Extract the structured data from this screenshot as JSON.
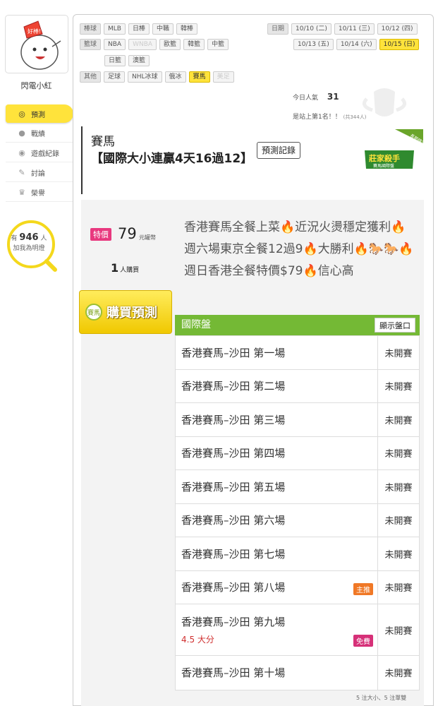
{
  "user": {
    "name": "閃電小紅",
    "avatar_bubble": "好棒!"
  },
  "nav": [
    {
      "label": "預測",
      "icon": "target-icon",
      "active": true
    },
    {
      "label": "戰績",
      "icon": "chat-icon",
      "active": false
    },
    {
      "label": "遊戲紀錄",
      "icon": "record-icon",
      "active": false
    },
    {
      "label": "討論",
      "icon": "discuss-icon",
      "active": false
    },
    {
      "label": "榮譽",
      "icon": "medal-icon",
      "active": false
    }
  ],
  "fans": {
    "prefix": "有",
    "count": "946",
    "suffix": "人",
    "line2": "加我為明燈"
  },
  "sports": {
    "baseball": {
      "label": "棒球",
      "items": [
        "MLB",
        "日棒",
        "中職",
        "韓棒"
      ]
    },
    "basketball": {
      "label": "籃球",
      "items": [
        "NBA",
        "WNBA",
        "歐籃",
        "韓籃",
        "中籃"
      ],
      "items2": [
        "日籃",
        "澳籃"
      ]
    },
    "other": {
      "label": "其他",
      "items": [
        "足球",
        "NHL冰球",
        "俄冰",
        "賽馬",
        "美足"
      ]
    }
  },
  "dates": {
    "label": "日期",
    "row1": [
      "10/10 (二)",
      "10/11 (三)",
      "10/12 (四)"
    ],
    "row2": [
      "10/13 (五)",
      "10/14 (六)",
      "10/15 (日)"
    ]
  },
  "popularity": {
    "label": "今日人氣",
    "value": "31"
  },
  "rank": {
    "text": "是站上第1名！！",
    "small": "(共344人)"
  },
  "title": {
    "line1": "賽馬",
    "line2": "【國際大小連贏4天16過12】",
    "button": "預測記錄",
    "badge_text": "莊家殺手",
    "badge_sub": "賽馬國際盤",
    "ribbon": "長期穩定"
  },
  "price": {
    "tag": "特價",
    "value": "79",
    "unit": "元罐幣"
  },
  "buyers": {
    "count": "1",
    "label": "人購買"
  },
  "buy_button": {
    "label": "購買預測",
    "icon_text": "賽馬"
  },
  "description": "香港賽馬全餐上菜🔥近況火燙穩定獲利🔥週六場東京全餐12過9🔥大勝利🔥🐎🐎🔥週日香港全餐特價$79🔥信心高",
  "pan": {
    "title": "國際盤",
    "button": "顯示盤口"
  },
  "races": [
    {
      "name": "香港賽馬–沙田 第一場",
      "status": "未開賽"
    },
    {
      "name": "香港賽馬–沙田 第二場",
      "status": "未開賽"
    },
    {
      "name": "香港賽馬–沙田 第三場",
      "status": "未開賽"
    },
    {
      "name": "香港賽馬–沙田 第四場",
      "status": "未開賽"
    },
    {
      "name": "香港賽馬–沙田 第五場",
      "status": "未開賽"
    },
    {
      "name": "香港賽馬–沙田 第六場",
      "status": "未開賽"
    },
    {
      "name": "香港賽馬–沙田 第七場",
      "status": "未開賽"
    },
    {
      "name": "香港賽馬–沙田 第八場",
      "status": "未開賽",
      "pill": "主推"
    },
    {
      "name": "香港賽馬–沙田 第九場",
      "status": "未開賽",
      "sub": "4.5 大分",
      "pill": "免費"
    },
    {
      "name": "香港賽馬–沙田 第十場",
      "status": "未開賽"
    }
  ],
  "footnote": "5 注大小、5 注單雙",
  "colors": {
    "accent_yellow": "#ffe33b",
    "green": "#74b935",
    "pink": "#e8387e",
    "orange": "#f07826"
  }
}
